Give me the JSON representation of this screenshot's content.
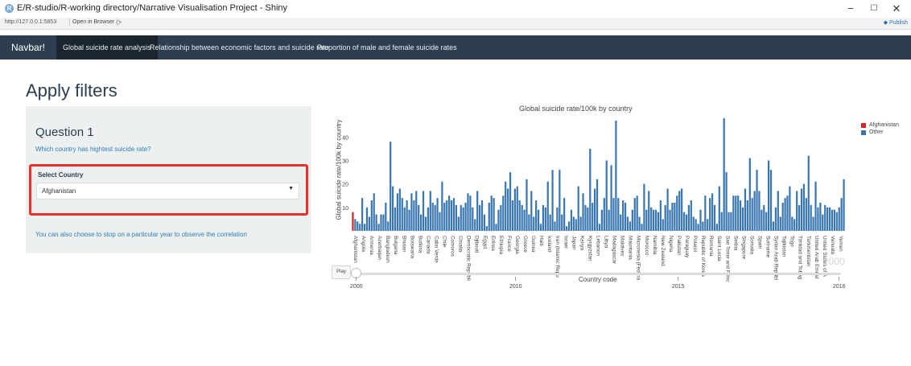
{
  "window": {
    "title": "E/R-studio/R-working directory/Narrative Visualisation Project - Shiny",
    "url": "http://127.0.0.1:5853",
    "open_in_browser": "Open in Browser",
    "publish": "Publish",
    "minimize": "−",
    "maximize": "☐",
    "close": "✕"
  },
  "navbar": {
    "brand": "Navbar!",
    "tabs": [
      {
        "label": "Global suicide rate analysis"
      },
      {
        "label": "Relationship between economic factors and suicide rate"
      },
      {
        "label": "Proportion of male and female suicide rates"
      }
    ]
  },
  "page": {
    "title": "Apply filters"
  },
  "sidebar": {
    "question_title": "Question 1",
    "question_subtitle": "Which country has hightest suicide rate?",
    "select_label": "Select Country",
    "select_value": "Afghanistan",
    "hint": "You can also choose to stop on a particular year to observe the correlation"
  },
  "player": {
    "play_label": "Play",
    "year_readout": "2000",
    "ticks": [
      "2000",
      "2010",
      "2015",
      "2016"
    ]
  },
  "colors": {
    "afghanistan": "#d62728",
    "other": "#3a77b0",
    "navbar": "#2c3e50",
    "highlight": "#e5332a"
  },
  "chart_data": {
    "type": "bar",
    "title": "Global suicide rate/100k by country",
    "xlabel": "Country code",
    "ylabel": "Global suicide rate/100k by country",
    "ylim": [
      0,
      48
    ],
    "yticks": [
      10,
      20,
      30,
      40
    ],
    "grid": false,
    "legend_position": "top-right",
    "series": [
      {
        "name": "Afghanistan",
        "color": "#d62728"
      },
      {
        "name": "Other",
        "color": "#3a77b0"
      }
    ],
    "tick_labels": [
      "Afghanistan",
      "Angola",
      "Armenia",
      "Azerbaijan",
      "Bangladesh",
      "Bulgaria",
      "Bhutan",
      "Botswana",
      "Burkina",
      "Canada",
      "Cabo Verde",
      "Chile",
      "Comoros",
      "Croatia",
      "Democratic Republic",
      "Djibouti",
      "Egypt",
      "Eritrea",
      "Ethiopia",
      "France",
      "Georgia",
      "Greece",
      "Guinea",
      "Haiti",
      "Iceland",
      "Iran (Islamic Repub",
      "Israel",
      "Japan",
      "Kenya",
      "Kyrgyzstan",
      "Lebanon",
      "Libya",
      "Madagascar",
      "Maldives",
      "Mauritania",
      "Micronesia (Federat",
      "Morocco",
      "Namibia",
      "New Zealand",
      "Nigeria",
      "Pakistan",
      "Paraguay",
      "Poland",
      "Republic of Korea",
      "Romania",
      "Saint Lucia",
      "Sao Tome and Princ",
      "Serbia",
      "Singapore",
      "Somalia",
      "Spain",
      "Suriname",
      "Syrian Arab Republi",
      "Tajikistan",
      "Togo",
      "Trinidad and Tobago",
      "Turkmenistan",
      "United Arab Emirates",
      "United States of Am",
      "Vanuatu",
      "Yemen"
    ],
    "categories_count": 183,
    "highlight_index": [
      0
    ],
    "values": [
      8,
      5,
      4,
      3,
      14,
      3,
      10,
      6,
      13,
      16,
      7,
      3,
      7,
      7,
      12,
      4,
      38,
      19,
      10,
      16,
      18,
      14,
      10,
      13,
      9,
      16,
      13,
      17,
      11,
      7,
      17,
      6,
      10,
      17,
      12,
      11,
      14,
      8,
      21,
      12,
      13,
      15,
      13,
      14,
      11,
      6,
      11,
      10,
      12,
      16,
      15,
      10,
      5,
      17,
      11,
      13,
      7,
      2,
      12,
      15,
      14,
      3,
      9,
      11,
      15,
      21,
      18,
      25,
      13,
      18,
      19,
      13,
      11,
      9,
      22,
      7,
      17,
      6,
      13,
      9,
      3,
      11,
      10,
      21,
      7,
      26,
      4,
      10,
      26,
      7,
      14,
      2,
      4,
      9,
      6,
      5,
      19,
      6,
      16,
      11,
      10,
      35,
      12,
      18,
      22,
      3,
      9,
      14,
      30,
      9,
      28,
      14,
      47,
      14,
      7,
      13,
      12,
      6,
      4,
      9,
      14,
      15,
      6,
      3,
      20,
      9,
      17,
      10,
      9,
      9,
      8,
      13,
      5,
      11,
      18,
      9,
      12,
      12,
      15,
      17,
      18,
      8,
      7,
      11,
      13,
      6,
      5,
      3,
      9,
      4,
      15,
      5,
      14,
      16,
      11,
      3,
      19,
      8,
      48,
      25,
      8,
      8,
      15,
      15,
      15,
      13,
      10,
      18,
      13,
      31,
      14,
      17,
      26,
      17,
      9,
      11,
      8,
      30,
      26,
      4,
      10,
      17,
      6,
      12,
      14,
      15,
      19,
      6,
      5,
      17,
      11,
      18,
      20,
      14,
      32,
      11,
      6,
      21,
      10,
      12,
      7,
      11,
      10,
      10,
      9,
      9,
      8,
      10,
      14,
      22
    ]
  }
}
